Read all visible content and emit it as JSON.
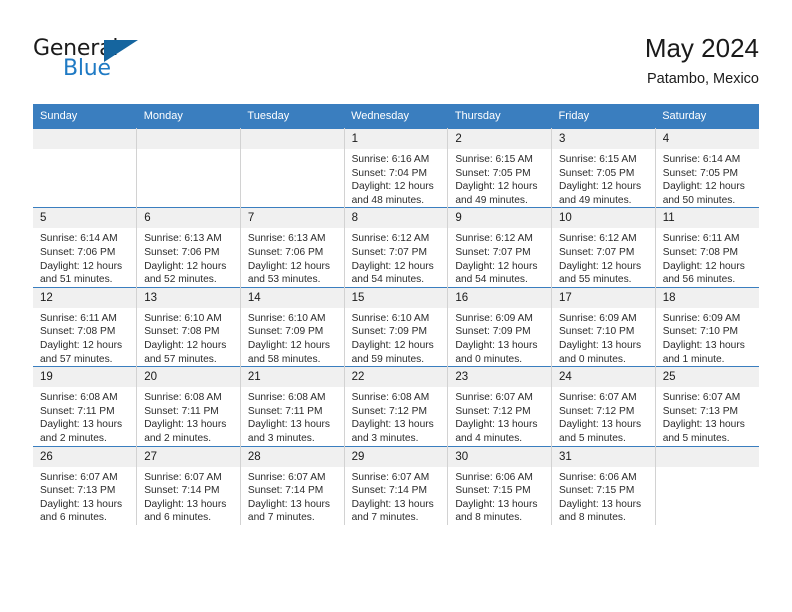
{
  "brand": {
    "word_one": "General",
    "word_two": "Blue",
    "accent_color": "#1f7ac4",
    "triangle_color": "#15659f"
  },
  "header": {
    "title": "May 2024",
    "location": "Patambo, Mexico"
  },
  "calendar": {
    "header_color": "#3a7ebf",
    "weekdays": [
      "Sunday",
      "Monday",
      "Tuesday",
      "Wednesday",
      "Thursday",
      "Friday",
      "Saturday"
    ],
    "labels": {
      "sunrise": "Sunrise:",
      "sunset": "Sunset:",
      "daylight": "Daylight:"
    },
    "weeks": [
      [
        {
          "day": "",
          "empty": true
        },
        {
          "day": "",
          "empty": true
        },
        {
          "day": "",
          "empty": true
        },
        {
          "day": "1",
          "sunrise": "Sunrise: 6:16 AM",
          "sunset": "Sunset: 7:04 PM",
          "daylight": "Daylight: 12 hours and 48 minutes."
        },
        {
          "day": "2",
          "sunrise": "Sunrise: 6:15 AM",
          "sunset": "Sunset: 7:05 PM",
          "daylight": "Daylight: 12 hours and 49 minutes."
        },
        {
          "day": "3",
          "sunrise": "Sunrise: 6:15 AM",
          "sunset": "Sunset: 7:05 PM",
          "daylight": "Daylight: 12 hours and 49 minutes."
        },
        {
          "day": "4",
          "sunrise": "Sunrise: 6:14 AM",
          "sunset": "Sunset: 7:05 PM",
          "daylight": "Daylight: 12 hours and 50 minutes."
        }
      ],
      [
        {
          "day": "5",
          "sunrise": "Sunrise: 6:14 AM",
          "sunset": "Sunset: 7:06 PM",
          "daylight": "Daylight: 12 hours and 51 minutes."
        },
        {
          "day": "6",
          "sunrise": "Sunrise: 6:13 AM",
          "sunset": "Sunset: 7:06 PM",
          "daylight": "Daylight: 12 hours and 52 minutes."
        },
        {
          "day": "7",
          "sunrise": "Sunrise: 6:13 AM",
          "sunset": "Sunset: 7:06 PM",
          "daylight": "Daylight: 12 hours and 53 minutes."
        },
        {
          "day": "8",
          "sunrise": "Sunrise: 6:12 AM",
          "sunset": "Sunset: 7:07 PM",
          "daylight": "Daylight: 12 hours and 54 minutes."
        },
        {
          "day": "9",
          "sunrise": "Sunrise: 6:12 AM",
          "sunset": "Sunset: 7:07 PM",
          "daylight": "Daylight: 12 hours and 54 minutes."
        },
        {
          "day": "10",
          "sunrise": "Sunrise: 6:12 AM",
          "sunset": "Sunset: 7:07 PM",
          "daylight": "Daylight: 12 hours and 55 minutes."
        },
        {
          "day": "11",
          "sunrise": "Sunrise: 6:11 AM",
          "sunset": "Sunset: 7:08 PM",
          "daylight": "Daylight: 12 hours and 56 minutes."
        }
      ],
      [
        {
          "day": "12",
          "sunrise": "Sunrise: 6:11 AM",
          "sunset": "Sunset: 7:08 PM",
          "daylight": "Daylight: 12 hours and 57 minutes."
        },
        {
          "day": "13",
          "sunrise": "Sunrise: 6:10 AM",
          "sunset": "Sunset: 7:08 PM",
          "daylight": "Daylight: 12 hours and 57 minutes."
        },
        {
          "day": "14",
          "sunrise": "Sunrise: 6:10 AM",
          "sunset": "Sunset: 7:09 PM",
          "daylight": "Daylight: 12 hours and 58 minutes."
        },
        {
          "day": "15",
          "sunrise": "Sunrise: 6:10 AM",
          "sunset": "Sunset: 7:09 PM",
          "daylight": "Daylight: 12 hours and 59 minutes."
        },
        {
          "day": "16",
          "sunrise": "Sunrise: 6:09 AM",
          "sunset": "Sunset: 7:09 PM",
          "daylight": "Daylight: 13 hours and 0 minutes."
        },
        {
          "day": "17",
          "sunrise": "Sunrise: 6:09 AM",
          "sunset": "Sunset: 7:10 PM",
          "daylight": "Daylight: 13 hours and 0 minutes."
        },
        {
          "day": "18",
          "sunrise": "Sunrise: 6:09 AM",
          "sunset": "Sunset: 7:10 PM",
          "daylight": "Daylight: 13 hours and 1 minute."
        }
      ],
      [
        {
          "day": "19",
          "sunrise": "Sunrise: 6:08 AM",
          "sunset": "Sunset: 7:11 PM",
          "daylight": "Daylight: 13 hours and 2 minutes."
        },
        {
          "day": "20",
          "sunrise": "Sunrise: 6:08 AM",
          "sunset": "Sunset: 7:11 PM",
          "daylight": "Daylight: 13 hours and 2 minutes."
        },
        {
          "day": "21",
          "sunrise": "Sunrise: 6:08 AM",
          "sunset": "Sunset: 7:11 PM",
          "daylight": "Daylight: 13 hours and 3 minutes."
        },
        {
          "day": "22",
          "sunrise": "Sunrise: 6:08 AM",
          "sunset": "Sunset: 7:12 PM",
          "daylight": "Daylight: 13 hours and 3 minutes."
        },
        {
          "day": "23",
          "sunrise": "Sunrise: 6:07 AM",
          "sunset": "Sunset: 7:12 PM",
          "daylight": "Daylight: 13 hours and 4 minutes."
        },
        {
          "day": "24",
          "sunrise": "Sunrise: 6:07 AM",
          "sunset": "Sunset: 7:12 PM",
          "daylight": "Daylight: 13 hours and 5 minutes."
        },
        {
          "day": "25",
          "sunrise": "Sunrise: 6:07 AM",
          "sunset": "Sunset: 7:13 PM",
          "daylight": "Daylight: 13 hours and 5 minutes."
        }
      ],
      [
        {
          "day": "26",
          "sunrise": "Sunrise: 6:07 AM",
          "sunset": "Sunset: 7:13 PM",
          "daylight": "Daylight: 13 hours and 6 minutes."
        },
        {
          "day": "27",
          "sunrise": "Sunrise: 6:07 AM",
          "sunset": "Sunset: 7:14 PM",
          "daylight": "Daylight: 13 hours and 6 minutes."
        },
        {
          "day": "28",
          "sunrise": "Sunrise: 6:07 AM",
          "sunset": "Sunset: 7:14 PM",
          "daylight": "Daylight: 13 hours and 7 minutes."
        },
        {
          "day": "29",
          "sunrise": "Sunrise: 6:07 AM",
          "sunset": "Sunset: 7:14 PM",
          "daylight": "Daylight: 13 hours and 7 minutes."
        },
        {
          "day": "30",
          "sunrise": "Sunrise: 6:06 AM",
          "sunset": "Sunset: 7:15 PM",
          "daylight": "Daylight: 13 hours and 8 minutes."
        },
        {
          "day": "31",
          "sunrise": "Sunrise: 6:06 AM",
          "sunset": "Sunset: 7:15 PM",
          "daylight": "Daylight: 13 hours and 8 minutes."
        },
        {
          "day": "",
          "empty": true
        }
      ]
    ]
  }
}
